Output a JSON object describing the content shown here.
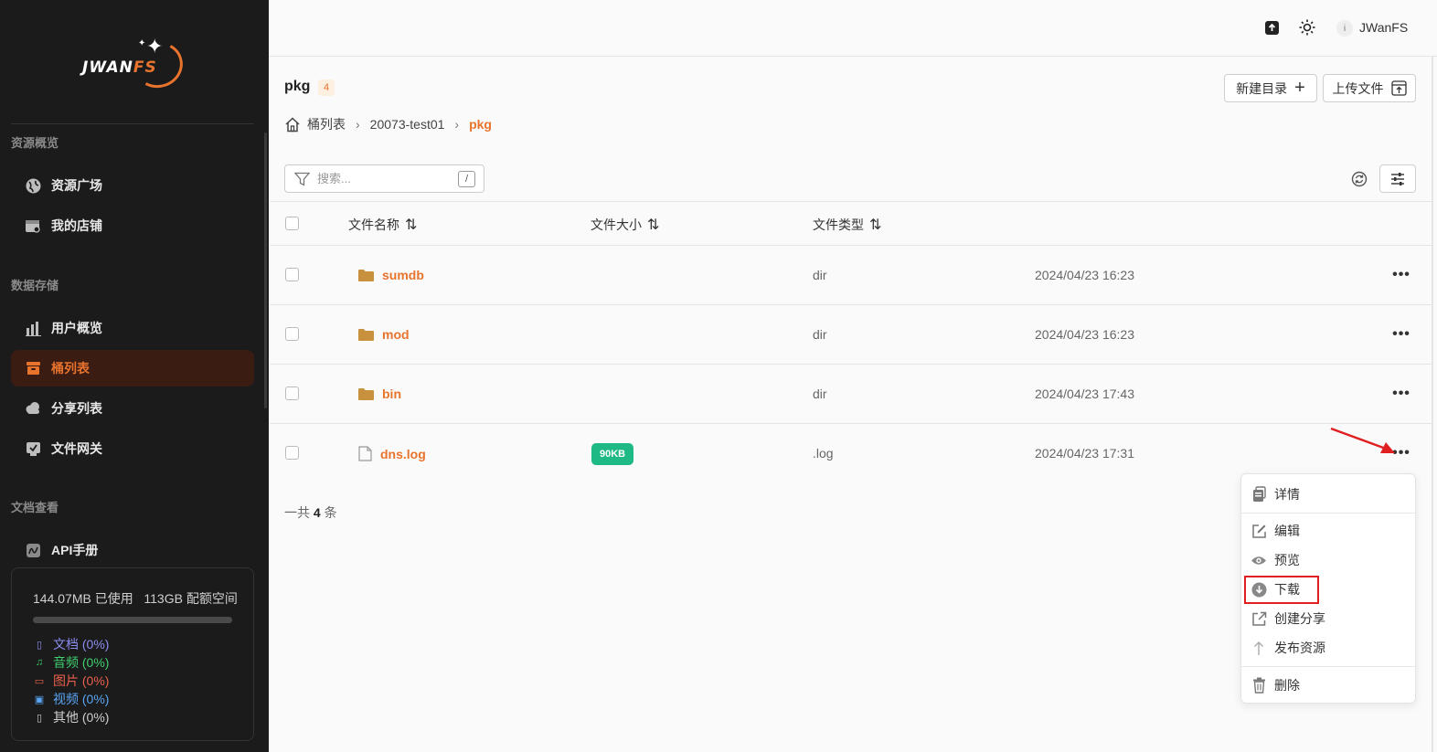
{
  "sidebar": {
    "logo": {
      "text_main": "JWAN",
      "text_accent": "FS"
    },
    "sections": [
      {
        "title": "资源概览",
        "items": [
          {
            "label": "资源广场",
            "icon": "globe-icon"
          },
          {
            "label": "我的店铺",
            "icon": "shop-icon"
          }
        ]
      },
      {
        "title": "数据存储",
        "items": [
          {
            "label": "用户概览",
            "icon": "bar-chart-icon"
          },
          {
            "label": "桶列表",
            "icon": "archive-icon",
            "active": true
          },
          {
            "label": "分享列表",
            "icon": "cloud-icon"
          },
          {
            "label": "文件网关",
            "icon": "gateway-icon"
          }
        ]
      },
      {
        "title": "文档查看",
        "items": [
          {
            "label": "API手册",
            "icon": "api-icon"
          }
        ]
      }
    ],
    "quota": {
      "used": "144.07MB 已使用",
      "total": "113GB 配额空间",
      "used_fraction": 0.0,
      "types": [
        {
          "label": "文档 (0%)",
          "color": "#8b8cf0",
          "icon": "document-icon"
        },
        {
          "label": "音频 (0%)",
          "color": "#3fcf6e",
          "icon": "music-icon"
        },
        {
          "label": "图片 (0%)",
          "color": "#e8604c",
          "icon": "image-icon"
        },
        {
          "label": "视频 (0%)",
          "color": "#5aa6f5",
          "icon": "film-icon"
        },
        {
          "label": "其他 (0%)",
          "color": "#cfcfcf",
          "icon": "file-icon"
        }
      ]
    }
  },
  "header": {
    "user_initial": "i",
    "username": "JWanFS"
  },
  "main": {
    "title": "pkg",
    "count": "4",
    "new_dir_label": "新建目录",
    "upload_label": "上传文件",
    "breadcrumb": [
      "桶列表",
      "20073-test01",
      "pkg"
    ],
    "search": {
      "placeholder": "搜索...",
      "shortcut": "/"
    },
    "columns": {
      "name": "文件名称",
      "size": "文件大小",
      "type": "文件类型"
    },
    "rows": [
      {
        "name": "sumdb",
        "kind": "folder",
        "size": "",
        "type": "dir",
        "modified": "2024/04/23 16:23"
      },
      {
        "name": "mod",
        "kind": "folder",
        "size": "",
        "type": "dir",
        "modified": "2024/04/23 16:23"
      },
      {
        "name": "bin",
        "kind": "folder",
        "size": "",
        "type": "dir",
        "modified": "2024/04/23 17:43"
      },
      {
        "name": "dns.log",
        "kind": "file",
        "size": "90KB",
        "type": ".log",
        "modified": "2024/04/23 17:31"
      }
    ],
    "total_prefix": "一共",
    "total_count": "4",
    "total_suffix": "条"
  },
  "menu": {
    "items": [
      {
        "label": "详情",
        "icon": "clipboard-icon"
      },
      {
        "label": "编辑",
        "icon": "edit-icon"
      },
      {
        "label": "预览",
        "icon": "eye-icon"
      },
      {
        "label": "下载",
        "icon": "download-icon"
      },
      {
        "label": "创建分享",
        "icon": "external-link-icon"
      },
      {
        "label": "发布资源",
        "icon": "arrow-up-icon"
      },
      {
        "label": "删除",
        "icon": "trash-icon"
      }
    ]
  },
  "colors": {
    "accent": "#e8732c",
    "success": "#1fb986",
    "highlight": "#e02020"
  }
}
